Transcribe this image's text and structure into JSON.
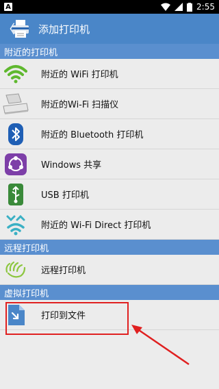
{
  "status_bar": {
    "time": "2:55"
  },
  "app_bar": {
    "title": "添加打印机",
    "back_symbol": "〈"
  },
  "sections": [
    {
      "title": "附近的打印机",
      "items": [
        {
          "label": "附近的 WiFi 打印机",
          "icon": "wifi-icon"
        },
        {
          "label": "附近的Wi-Fi 扫描仪",
          "icon": "scanner-icon"
        },
        {
          "label": "附近的 Bluetooth 打印机",
          "icon": "bluetooth-icon"
        },
        {
          "label": "Windows 共享",
          "icon": "windows-share-icon"
        },
        {
          "label": "USB 打印机",
          "icon": "usb-icon"
        },
        {
          "label": "附近的 Wi-Fi Direct 打印机",
          "icon": "wifi-direct-icon"
        }
      ]
    },
    {
      "title": "远程打印机",
      "items": [
        {
          "label": "远程打印机",
          "icon": "remote-hand-icon"
        }
      ]
    },
    {
      "title": "虚拟打印机",
      "items": [
        {
          "label": "打印到文件",
          "icon": "file-icon"
        }
      ]
    }
  ],
  "colors": {
    "appbar": "#4a86c8",
    "section": "#5a8fcf",
    "highlight": "#e02020",
    "wifi_green": "#5fb82e"
  }
}
